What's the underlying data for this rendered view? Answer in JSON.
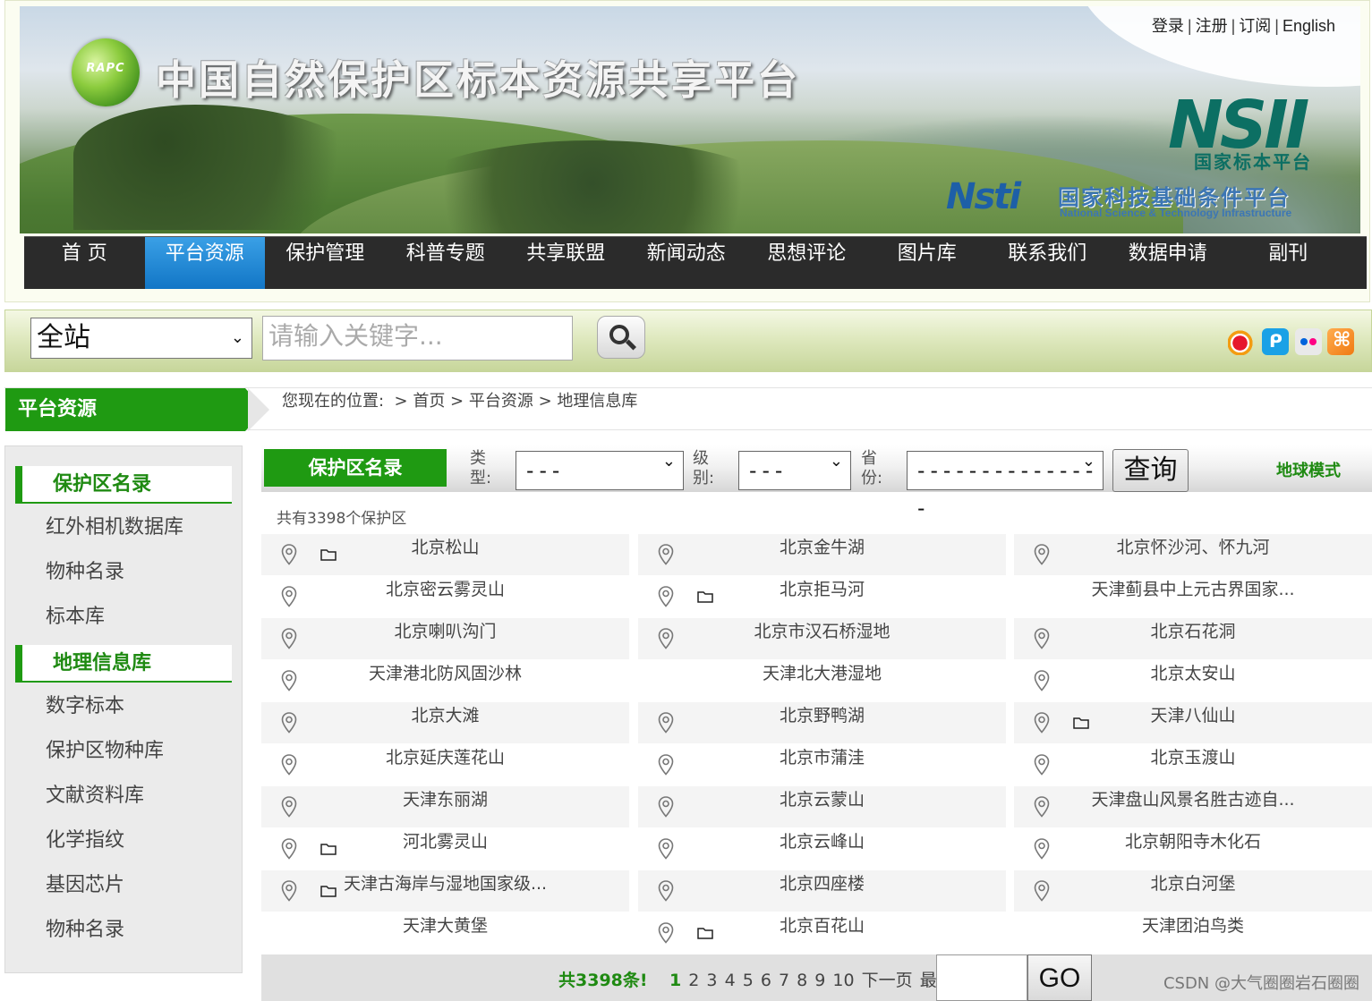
{
  "header": {
    "logo_text": "RAPC",
    "site_title": "中国自然保护区标本资源共享平台",
    "top_links": [
      "登录",
      "注册",
      "订阅",
      "English"
    ],
    "partner_logo_1": "NSII",
    "partner_logo_1_sub": "国家标本平台",
    "partner_logo_2": "Nsti",
    "partner_logo_2_cn": "国家科技基础条件平台",
    "partner_logo_2_en": "National Science & Technology Infrastructure"
  },
  "nav": {
    "items": [
      "首 页",
      "平台资源",
      "保护管理",
      "科普专题",
      "共享联盟",
      "新闻动态",
      "思想评论",
      "图片库",
      "联系我们",
      "数据申请",
      "副刊"
    ],
    "active_index": 1
  },
  "search": {
    "scope_value": "全站",
    "placeholder": "请输入关键字...",
    "button_icon": "magnifier-icon",
    "social_icons": [
      "weibo-icon",
      "qq-weibo-icon",
      "flickr-icon",
      "rss-icon"
    ]
  },
  "section": {
    "tab_label": "平台资源",
    "breadcrumb_prefix": "您现在的位置:",
    "breadcrumb": [
      "首页",
      "平台资源",
      "地理信息库"
    ]
  },
  "sidebar": {
    "items": [
      {
        "label": "保护区名录",
        "head": true
      },
      {
        "label": "红外相机数据库",
        "head": false
      },
      {
        "label": "物种名录",
        "head": false
      },
      {
        "label": "标本库",
        "head": false
      },
      {
        "label": "地理信息库",
        "head": true
      },
      {
        "label": "数字标本",
        "head": false
      },
      {
        "label": "保护区物种库",
        "head": false
      },
      {
        "label": "文献资料库",
        "head": false
      },
      {
        "label": "化学指纹",
        "head": false
      },
      {
        "label": "基因芯片",
        "head": false
      },
      {
        "label": "物种名录",
        "head": false
      }
    ]
  },
  "filter": {
    "title": "保护区名录",
    "type_label": "类型:",
    "type_value": "---",
    "level_label": "级别:",
    "level_value": "---",
    "province_label": "省份:",
    "province_value": "---------------",
    "query_button": "查询",
    "globe_mode": "地球模式"
  },
  "list": {
    "total_text": "共有3398个保护区",
    "rows": [
      [
        {
          "name": "北京松山",
          "pin": true,
          "folder": true
        },
        {
          "name": "北京金牛湖",
          "pin": true,
          "folder": false
        },
        {
          "name": "北京怀沙河、怀九河",
          "pin": true,
          "folder": false
        }
      ],
      [
        {
          "name": "北京密云雾灵山",
          "pin": true,
          "folder": false
        },
        {
          "name": "北京拒马河",
          "pin": true,
          "folder": true
        },
        {
          "name": "天津蓟县中上元古界国家...",
          "pin": false,
          "folder": false
        }
      ],
      [
        {
          "name": "北京喇叭沟门",
          "pin": true,
          "folder": false
        },
        {
          "name": "北京市汉石桥湿地",
          "pin": true,
          "folder": false
        },
        {
          "name": "北京石花洞",
          "pin": true,
          "folder": false
        }
      ],
      [
        {
          "name": "天津港北防风固沙林",
          "pin": true,
          "folder": false
        },
        {
          "name": "天津北大港湿地",
          "pin": false,
          "folder": false
        },
        {
          "name": "北京太安山",
          "pin": true,
          "folder": false
        }
      ],
      [
        {
          "name": "北京大滩",
          "pin": true,
          "folder": false
        },
        {
          "name": "北京野鸭湖",
          "pin": true,
          "folder": false
        },
        {
          "name": "天津八仙山",
          "pin": true,
          "folder": true
        }
      ],
      [
        {
          "name": "北京延庆莲花山",
          "pin": true,
          "folder": false
        },
        {
          "name": "北京市蒲洼",
          "pin": true,
          "folder": false
        },
        {
          "name": "北京玉渡山",
          "pin": true,
          "folder": false
        }
      ],
      [
        {
          "name": "天津东丽湖",
          "pin": true,
          "folder": false
        },
        {
          "name": "北京云蒙山",
          "pin": true,
          "folder": false
        },
        {
          "name": "天津盘山风景名胜古迹自...",
          "pin": true,
          "folder": false
        }
      ],
      [
        {
          "name": "河北雾灵山",
          "pin": true,
          "folder": true
        },
        {
          "name": "北京云峰山",
          "pin": true,
          "folder": false
        },
        {
          "name": "北京朝阳寺木化石",
          "pin": true,
          "folder": false
        }
      ],
      [
        {
          "name": "天津古海岸与湿地国家级...",
          "pin": true,
          "folder": true
        },
        {
          "name": "北京四座楼",
          "pin": true,
          "folder": false
        },
        {
          "name": "北京白河堡",
          "pin": true,
          "folder": false
        }
      ],
      [
        {
          "name": "天津大黄堡",
          "pin": false,
          "folder": false
        },
        {
          "name": "北京百花山",
          "pin": true,
          "folder": true
        },
        {
          "name": "天津团泊鸟类",
          "pin": false,
          "folder": false
        }
      ]
    ]
  },
  "pager": {
    "total": "共3398条!",
    "current_page": "1",
    "pages": [
      "2",
      "3",
      "4",
      "5",
      "6",
      "7",
      "8",
      "9",
      "10"
    ],
    "next": "下一页",
    "last": "最后",
    "page_input_value": "",
    "go_label": "GO"
  },
  "watermark": "CSDN @大气圈圈岩石圈圈",
  "colors": {
    "green_accent": "#1f9a12",
    "nav_bg": "#2b2b2b",
    "nav_active": "#1276c6",
    "row_stripe": "#f4f4f4"
  }
}
